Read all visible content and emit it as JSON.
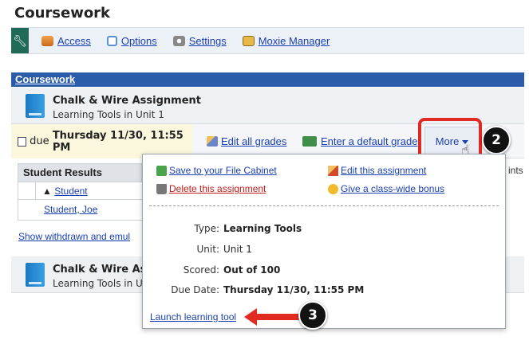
{
  "page": {
    "title": "Coursework"
  },
  "topnav": [
    {
      "label": "Access",
      "icon": "people-icon"
    },
    {
      "label": "Options",
      "icon": "options-icon"
    },
    {
      "label": "Settings",
      "icon": "gear-icon"
    },
    {
      "label": "Moxie Manager",
      "icon": "moxie-icon"
    }
  ],
  "section": {
    "header": "Coursework"
  },
  "assignment": {
    "title": "Chalk & Wire Assignment",
    "unit": "Learning Tools in Unit 1"
  },
  "assignment2": {
    "title": "Chalk & Wire Ass",
    "unit": "Learning Tools in U"
  },
  "due": {
    "prefix": "due",
    "date": "Thursday 11/30, 11:55 PM"
  },
  "actions": {
    "edit_all_grades": "Edit all grades",
    "enter_default_grade": "Enter a default grade",
    "more": "More"
  },
  "results": {
    "header": "Student Results",
    "column": "Student",
    "rows": [
      "Student, Joe"
    ],
    "show_withdrawn": "Show withdrawn and emul",
    "right_text": "ints"
  },
  "popup": {
    "save": "Save to your File Cabinet",
    "edit": "Edit this assignment",
    "delete": "Delete this assignment",
    "bonus": "Give a class-wide bonus",
    "type_label": "Type:",
    "type_value": "Learning Tools",
    "unit_label": "Unit:",
    "unit_value": "Unit 1",
    "scored_label": "Scored:",
    "scored_value": "Out of 100",
    "due_label": "Due Date:",
    "due_value": "Thursday 11/30, 11:55 PM",
    "launch": "Launch learning tool"
  },
  "callouts": {
    "two": "2",
    "three": "3"
  },
  "colors": {
    "header_blue": "#2a5caa",
    "link": "#1a3fb0",
    "callout_red": "#e02a22",
    "due_bg": "#fbf7dd"
  }
}
